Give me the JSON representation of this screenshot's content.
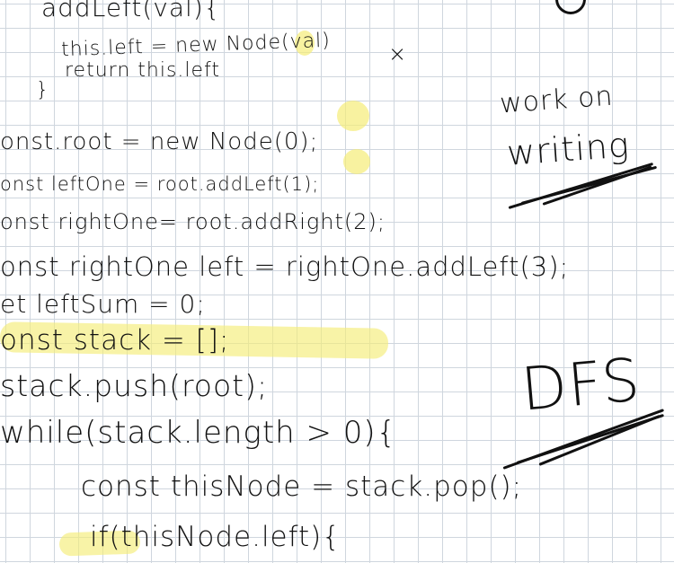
{
  "lines": [
    "addLeft(val){",
    "this.left = new Node(val)",
    "return this.left",
    "}",
    "onst.root = new Node(0);",
    "onst leftOne = root.addLeft(1);",
    "onst rightOne= root.addRight(2);",
    "onst rightOne left = rightOne.addLeft(3);",
    "et leftSum = 0;",
    "onst stack = [];",
    "stack.push(root);",
    "while(stack.length > 0){",
    "const thisNode = stack.pop();",
    "if(thisNode.left){"
  ],
  "notes": [
    "work on",
    "writing",
    "DFS"
  ],
  "marks": [
    "×"
  ]
}
